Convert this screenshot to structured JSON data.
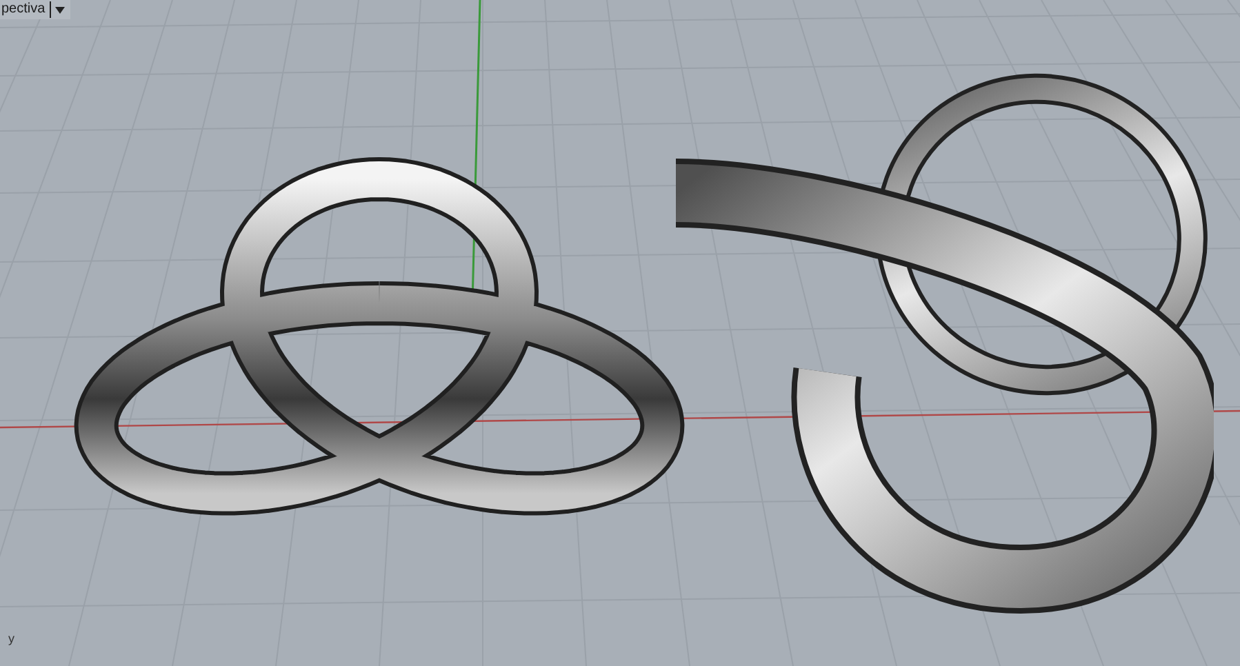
{
  "viewport": {
    "label": "pectiva",
    "axis_label": "y"
  }
}
